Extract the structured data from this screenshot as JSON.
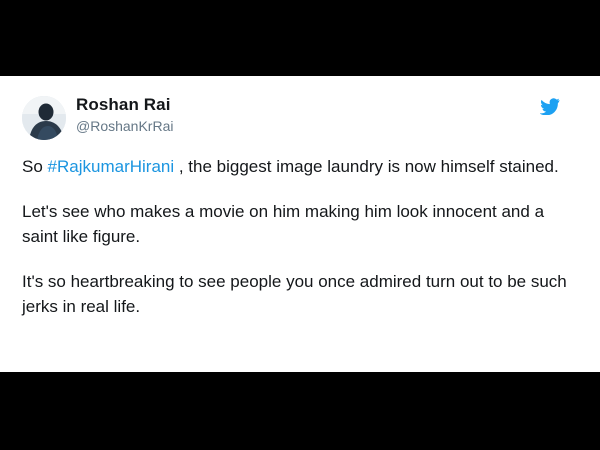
{
  "tweet": {
    "author_name": "Roshan Rai",
    "author_handle": "@RoshanKrRai",
    "accent_color": "#1b95e0",
    "icon": "twitter-bird-icon",
    "paragraph1": {
      "before": "So ",
      "hashtag": "#RajkumarHirani",
      "after": " , the biggest image laundry is now himself stained."
    },
    "paragraph2": "Let's see who makes a movie on him making him look innocent and a saint like figure.",
    "paragraph3": "It's so heartbreaking to see people you once admired turn out to be such jerks in real life."
  }
}
